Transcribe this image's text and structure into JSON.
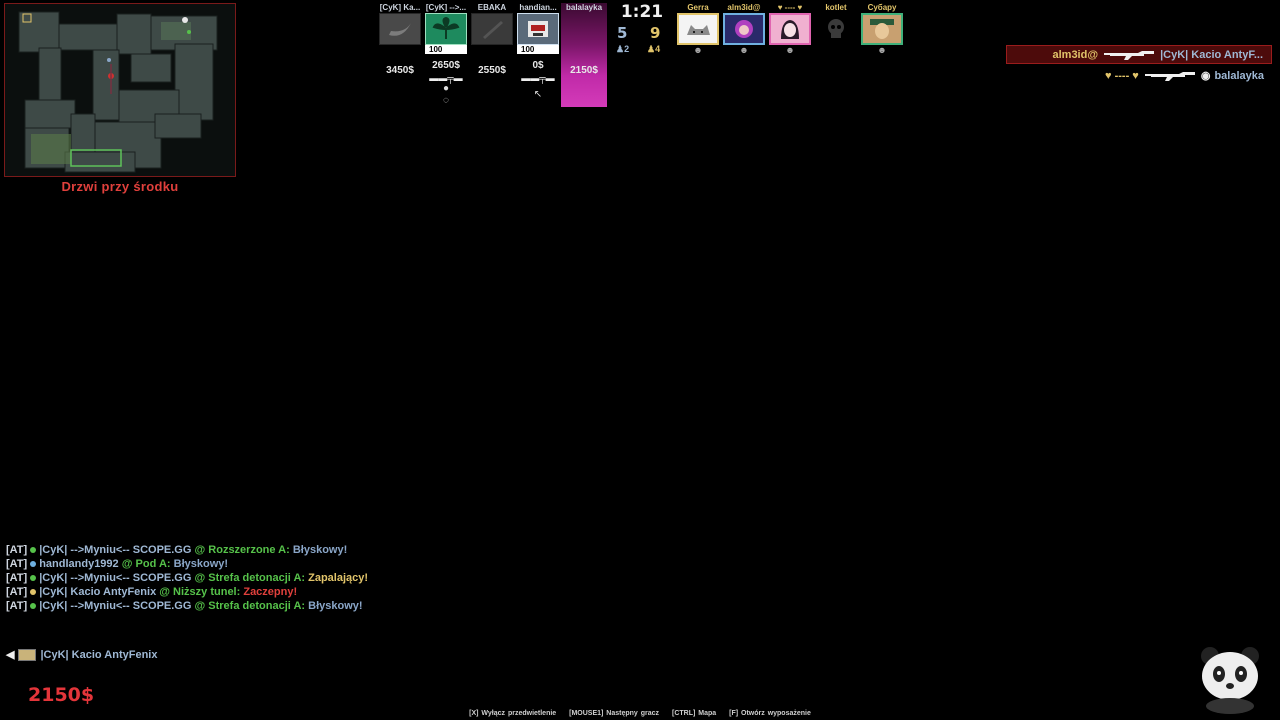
{
  "radar": {
    "location": "Drzwi przy środku"
  },
  "scoreboard": {
    "timer": "1:21",
    "score_ct": "5",
    "score_t": "9",
    "alive_ct": "♟2",
    "alive_t": "♟4",
    "ct_players": [
      {
        "name": "[CyK] Ka...",
        "hp": "",
        "money": "3450$",
        "weapon": "",
        "utility": "",
        "avatar": "banana",
        "alive": false
      },
      {
        "name": "[CyK] -->...",
        "hp": "100",
        "money": "2650$",
        "weapon": "▬▬╤▬",
        "utility": "●",
        "avatar": "plant",
        "alive": true
      },
      {
        "name": "EBAKA",
        "hp": "",
        "money": "2550$",
        "weapon": "",
        "utility": "",
        "avatar": "knife",
        "alive": false
      },
      {
        "name": "handian...",
        "hp": "100",
        "money": "0$",
        "weapon": "▬▬╤▬",
        "utility": "",
        "avatar": "robot",
        "alive": true
      },
      {
        "name": "balalayka",
        "hp": "",
        "money": "2150$",
        "weapon": "",
        "utility": "",
        "avatar": "none",
        "alive": false
      }
    ],
    "t_players": [
      {
        "name": "Gerra",
        "avatar": "cat",
        "border": "#e1c46a"
      },
      {
        "name": "alm3id@",
        "avatar": "girl-purple",
        "border": "#6fb0e0"
      },
      {
        "name": "♥ ---- ♥",
        "avatar": "anime",
        "border": "#e064b0"
      },
      {
        "name": "kotlet",
        "avatar": "skull",
        "border": "#000000"
      },
      {
        "name": "Субару",
        "avatar": "face",
        "border": "#3fb07a"
      }
    ],
    "skull_glyph": "☻"
  },
  "killfeed": [
    {
      "attacker": "alm3id@",
      "attacker_side": "t",
      "victim": "|CyK| Kacio AntyF...",
      "victim_side": "ct",
      "self": true
    },
    {
      "attacker": "♥ ---- ♥",
      "attacker_side": "t",
      "victim": "balalayka",
      "victim_side": "ct",
      "self": false
    }
  ],
  "chat": [
    {
      "tag": "[AT]",
      "name": "|CyK| -->Myniu<-- SCOPE.GG",
      "location": "Rozszerzone A:",
      "value": "Błyskowy!",
      "value_color": "blue"
    },
    {
      "tag": "[AT]",
      "name": "handlandy1992",
      "location": "Pod A:",
      "value": "Błyskowy!",
      "value_color": "blue"
    },
    {
      "tag": "[AT]",
      "name": "|CyK| -->Myniu<-- SCOPE.GG",
      "location": "Strefa detonacji A:",
      "value": "Zapalający!",
      "value_color": "yellow"
    },
    {
      "tag": "[AT]",
      "name": "|CyK| Kacio AntyFenix",
      "location": "Niższy tunel:",
      "value": "Zaczepny!",
      "value_color": "red"
    },
    {
      "tag": "[AT]",
      "name": "|CyK| -->Myniu<-- SCOPE.GG",
      "location": "Strefa detonacji A:",
      "value": "Błyskowy!",
      "value_color": "blue"
    }
  ],
  "voice": {
    "speaker": "|CyK| Kacio AntyFenix"
  },
  "cash": "2150$",
  "hints": [
    "[X] Wyłącz przedwietlenie",
    "[MOUSE1] Następny gracz",
    "[CTRL] Mapa",
    "[F] Otwórz wyposażenie"
  ],
  "colors": {
    "ct": "#9fb8d4",
    "t": "#e1c46a",
    "accent_red": "#e0403c",
    "location_green": "#56c24a"
  }
}
